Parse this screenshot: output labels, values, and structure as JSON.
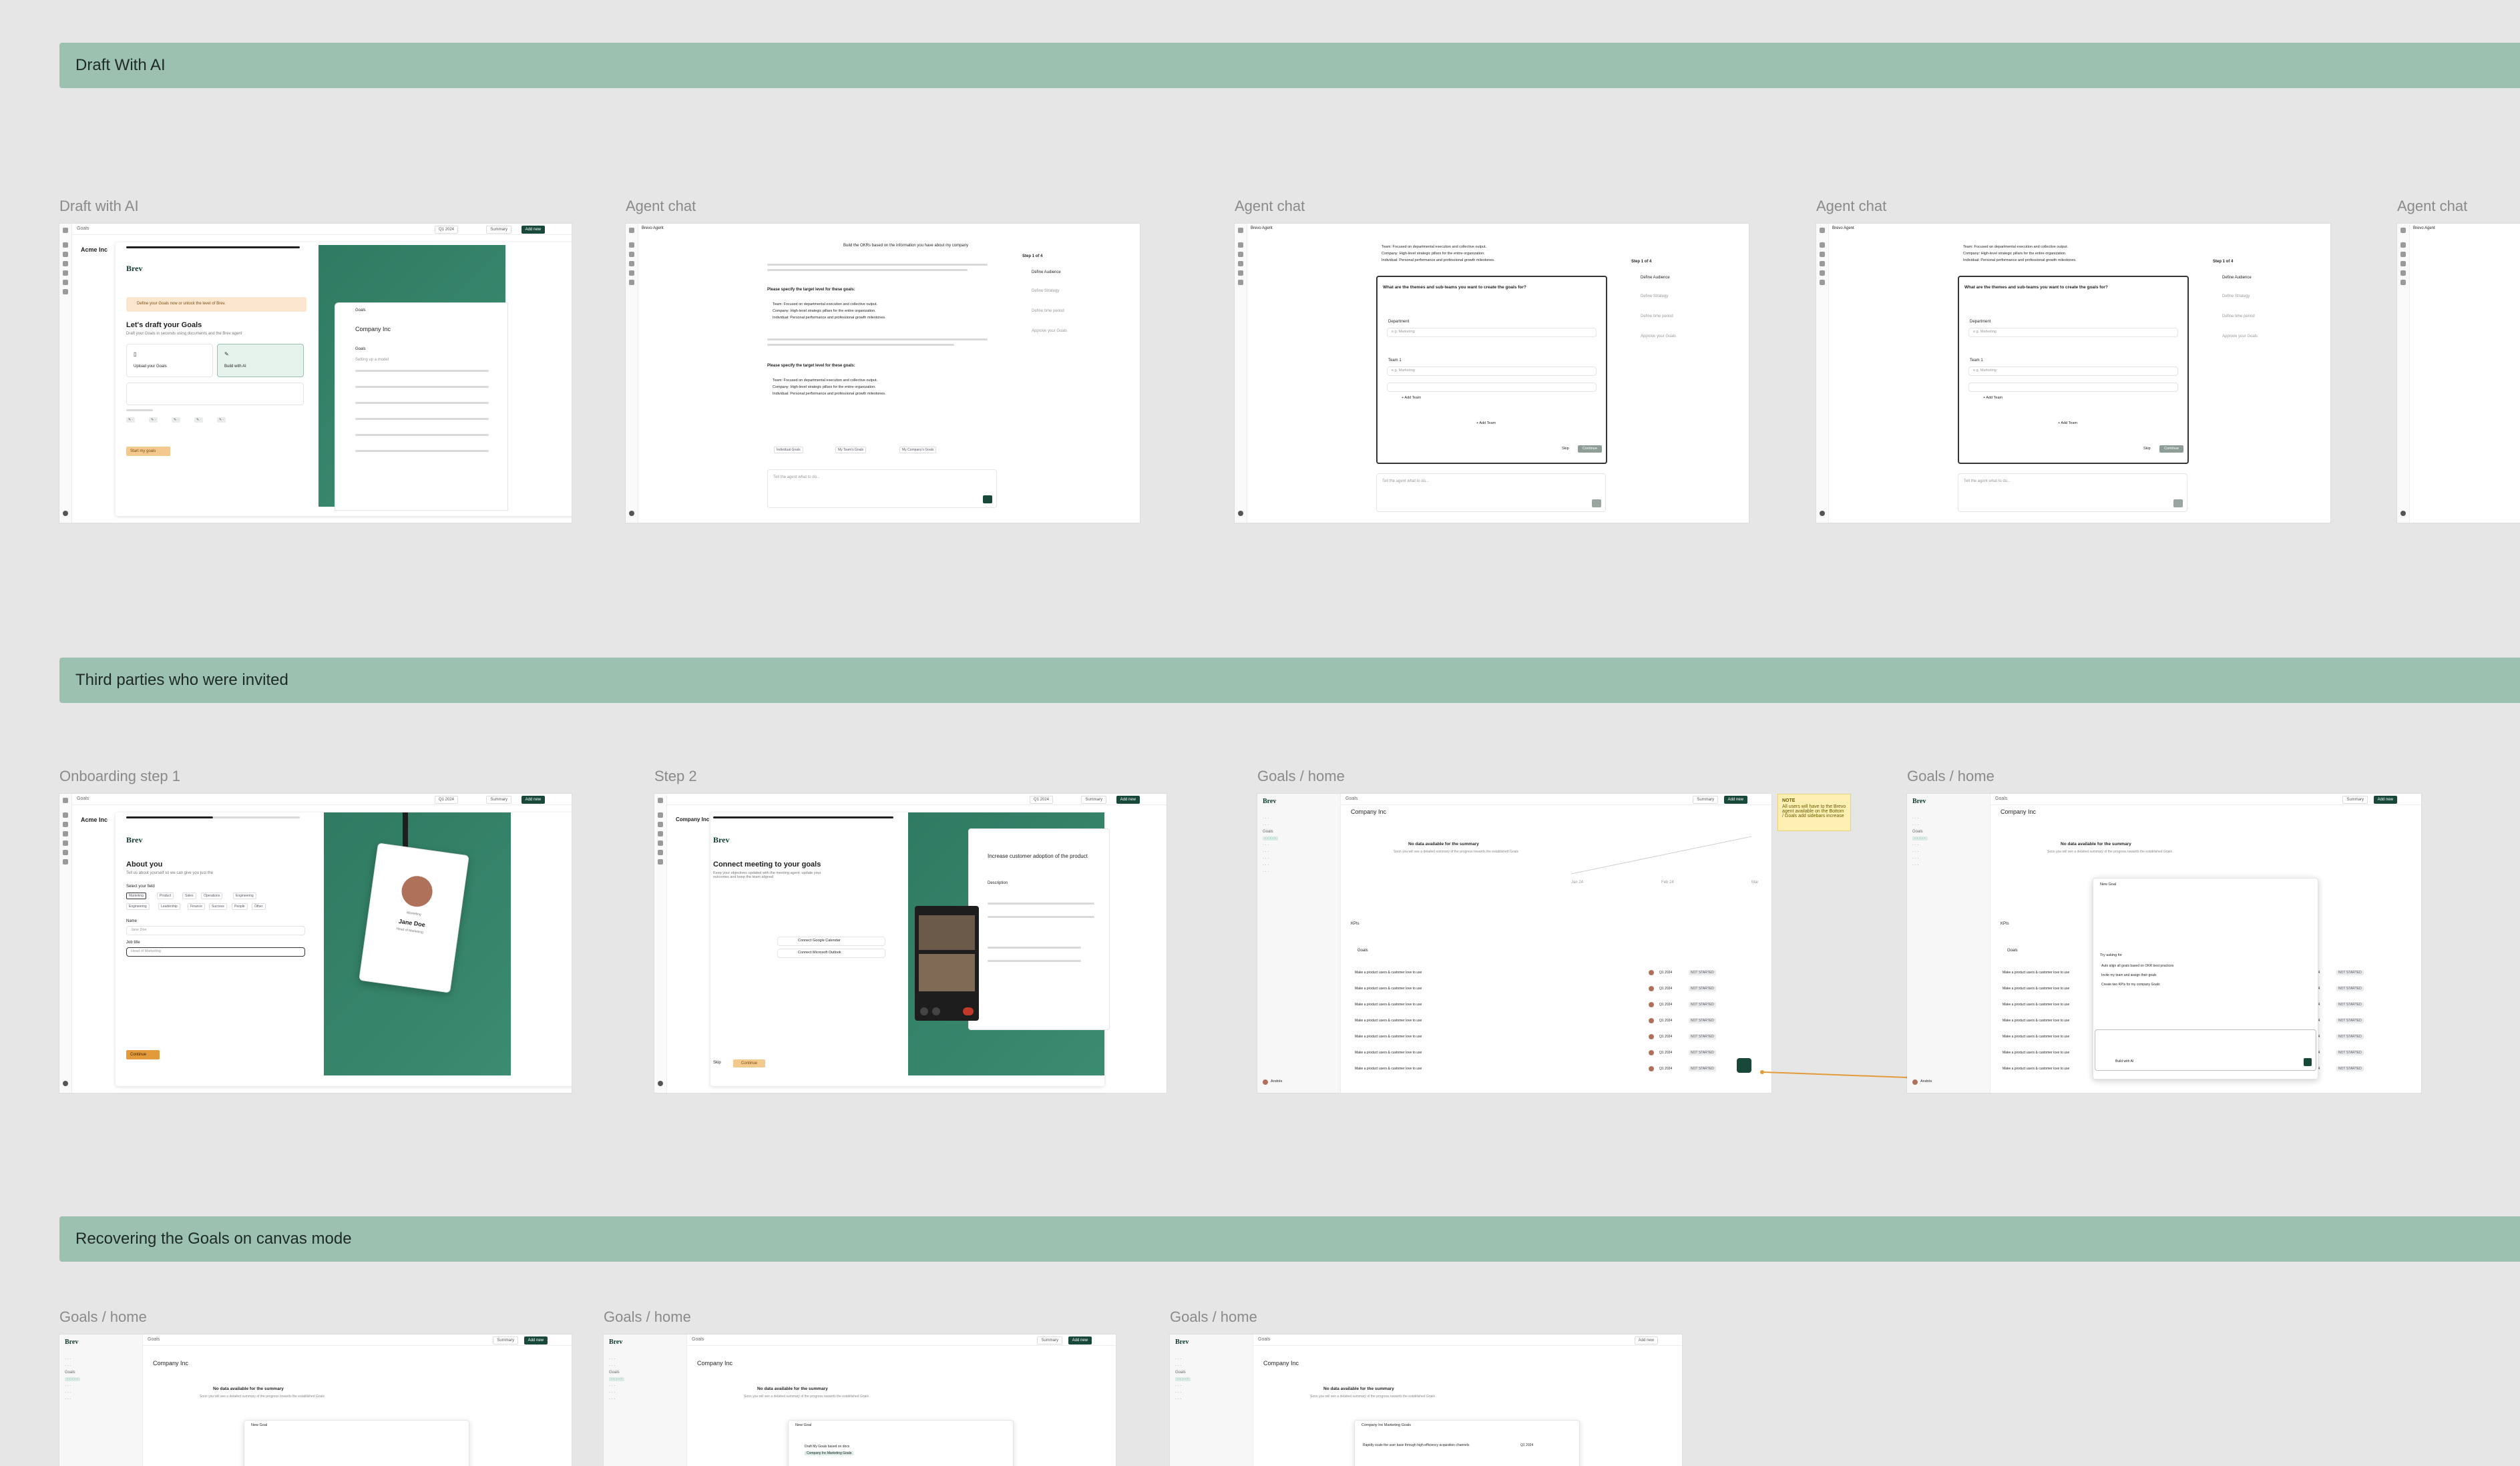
{
  "sections": {
    "s1": "Draft With AI",
    "s2": "Third parties who were invited",
    "s3": "Recovering the Goals on canvas mode"
  },
  "labels": {
    "f1": "Draft with AI",
    "f2": "Agent chat",
    "f3": "Agent chat",
    "f4": "Agent chat",
    "f5": "Agent chat",
    "f6": "Onboarding step 1",
    "f7": "Step 2",
    "f8": "Goals / home",
    "f9": "Goals / home",
    "f10": "Goals / home",
    "f11": "Goals / home",
    "f12": "Goals / home"
  },
  "app": {
    "crumb_goals": "Goals",
    "brand": "Brev",
    "company": "Company Inc",
    "acme": "Acme Inc",
    "summary_btn": "Summary",
    "add_btn": "Add new",
    "period": "Q1 2024"
  },
  "draft": {
    "title": "Let's draft your Goals",
    "subtitle": "Draft your Goals in seconds using documents and the Brev agent",
    "notice": "Define your Goals now or unlock the level of Brev.",
    "opt_upload": "Upload your Goals",
    "opt_ai": "Build with AI",
    "start_btn": "Start my goals",
    "goals_label": "Goals",
    "setting_label": "Setting up a model"
  },
  "agent": {
    "title": "Brevo Agent",
    "steps_title": "Step 1 of 4",
    "step1": "Define Audience",
    "step2": "Define Strategy",
    "step3": "Define time period",
    "step4": "Approve your Goals",
    "question": "What are the themes and sub-teams you want to create the goals for?",
    "dept_label": "Department",
    "dept_placeholder": "e.g. Marketing",
    "team_label": "Team 1",
    "team_placeholder": "e.g. Marketing",
    "add_team": "+ Add Team",
    "skip_btn": "Skip",
    "continue_btn": "Continue",
    "input_placeholder": "Tell the agent what to do...",
    "chip1": "Individual Goals",
    "chip2": "My Team's Goals",
    "chip3": "My Company's Goals",
    "prompt_header": "Build the OKRs based on the information you have about my company",
    "reply_bullets": [
      "Team: Focused on departmental execution and collective output.",
      "Company: High-level strategic pillars for the entire organization.",
      "Individual: Personal performance and professional growth milestones."
    ],
    "reply_ask": "Please specify the target level for these goals:"
  },
  "onboarding": {
    "about_title": "About you",
    "about_sub": "Tell us about yourself so we can give you just the",
    "field_label": "Select your field",
    "fields": [
      "Marketing",
      "Product",
      "Sales",
      "Operations",
      "Engineering",
      "Engineering",
      "Leadership",
      "Finance",
      "Success",
      "People",
      "Other"
    ],
    "name_label": "Name",
    "name_value": "Jane Doe",
    "role_label": "Job title",
    "role_value": "Head of Marketing",
    "continue": "Continue",
    "badge_name": "Jane Doe",
    "badge_role": "Head of Marketing",
    "badge_dept": "Marketing"
  },
  "step2": {
    "title": "Connect meeting to your goals",
    "sub": "Keep your objectives updated with the meeting agent: update your outcomes and keep the team aligned",
    "google": "Connect Google Calendar",
    "microsoft": "Connect Microsoft Outlook",
    "skip": "Skip",
    "continue": "Continue",
    "panel_title": "Increase customer adoption of the product",
    "description": "Description"
  },
  "goals": {
    "empty_title": "No data available for the summary",
    "empty_sub": "Soon you will see a detailed summary of the progress towards the established Goals",
    "kpis": "KPIs",
    "goals_header": "Goals",
    "row_text": "Make a product users & customer love to use",
    "status": "NOT STARTED",
    "date": "Q1 2024",
    "sticky": "All users will have to the Brevo agent available on the Bottom / Goals add sidebars increase",
    "sticky_title": "NOTE",
    "user_name": "Andrés",
    "agent_prompt": "Try asking for",
    "suggest1": "Auto align all goals based on OKR best practices",
    "suggest2": "Invite my team and assign their goals",
    "suggest3": "Create two KPIs for my company Goals",
    "build_with": "Build with AI",
    "new_goal": "New Goal",
    "dropdown1": "Draft My Goals based on docs",
    "dropdown2": "Company Inc Marketing Goals",
    "row_alt": "Rapidly scale the user base through high-efficiency acquisition channels"
  },
  "chart_data": {
    "type": "line",
    "x": [
      "Jan 24",
      "Feb 24",
      "Mar 24"
    ],
    "series": [
      {
        "values": [
          0,
          0.4,
          0.8
        ]
      }
    ]
  },
  "colors": {
    "band": "#9cc1b1",
    "brand_green": "#17483a",
    "panel_green": "#2f7a62",
    "accent_orange": "#e39a3b"
  }
}
